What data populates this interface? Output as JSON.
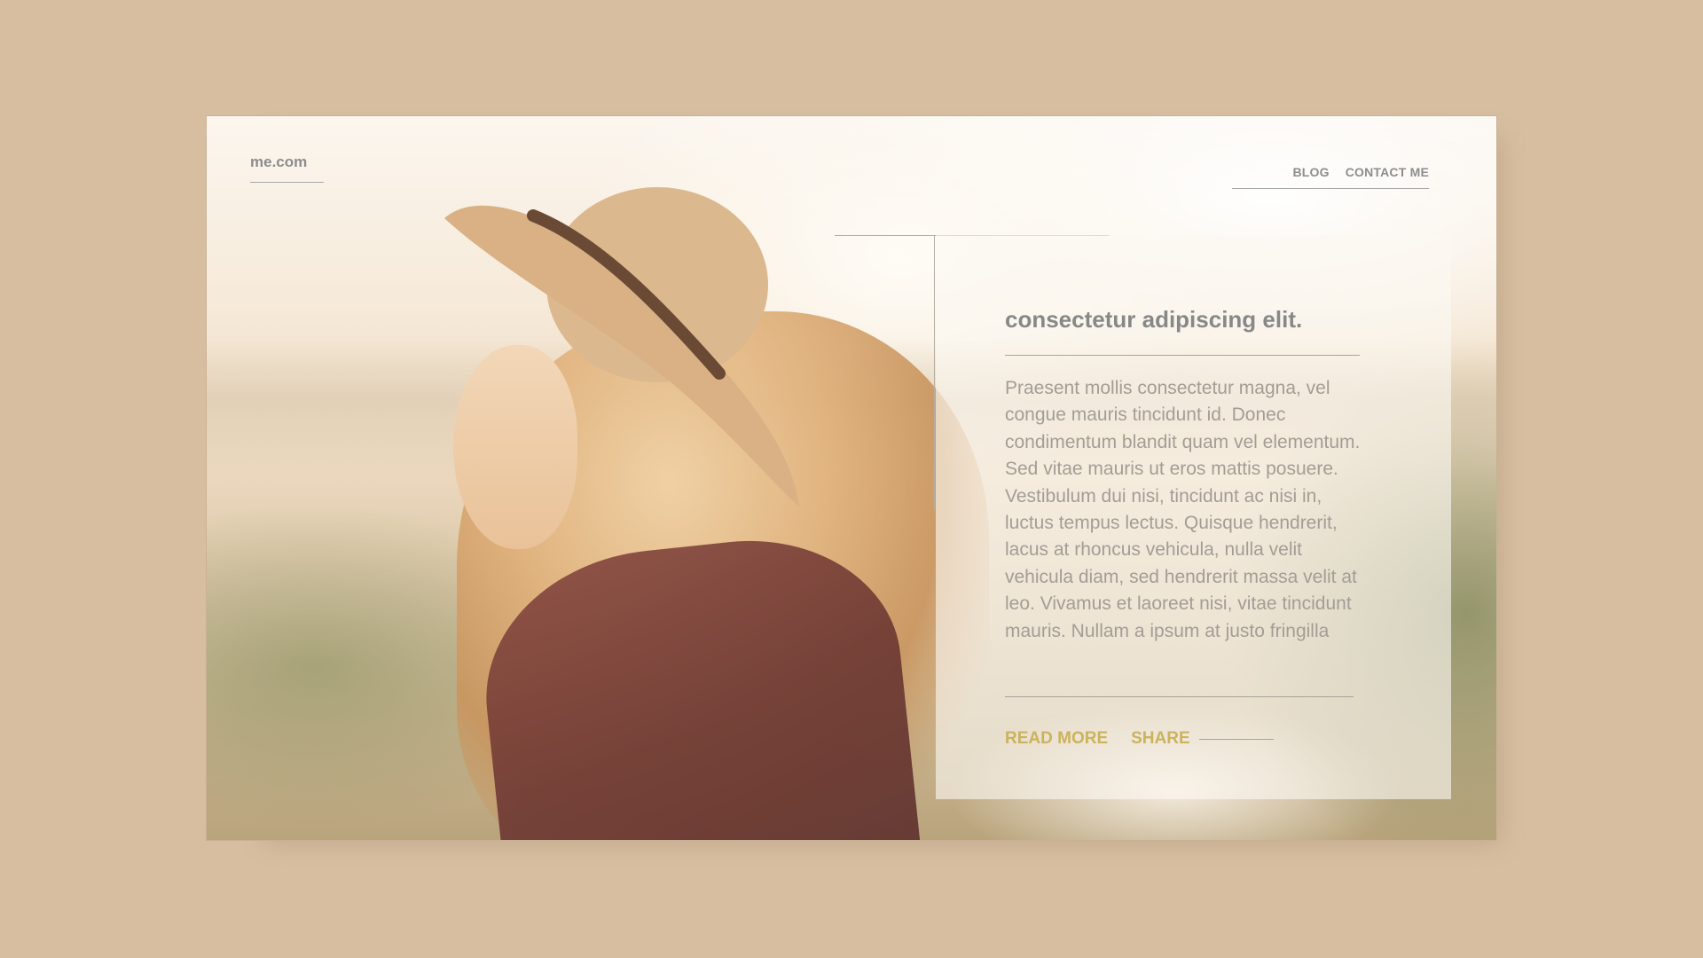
{
  "header": {
    "brand": "me.com",
    "nav": [
      {
        "label": "BLOG"
      },
      {
        "label": "CONTACT ME"
      }
    ]
  },
  "article": {
    "title": "consectetur adipiscing elit.",
    "body": "Praesent mollis consectetur magna, vel congue mauris tincidunt id. Donec condimentum blandit quam vel elementum. Sed vitae mauris ut eros mattis posuere. Vestibulum dui nisi, tincidunt ac nisi in, luctus tempus lectus. Quisque hendrerit, lacus at rhoncus vehicula, nulla velit vehicula diam, sed hendrerit massa velit at leo. Vivamus et laoreet nisi, vitae tincidunt mauris. Nullam a ipsum at justo fringilla",
    "read_more": "READ MORE",
    "share": "SHARE"
  },
  "colors": {
    "background": "#d7bea1",
    "accent": "#cbb35d",
    "text_gray": "#888888"
  },
  "hero_image": "woman-in-hat-backlit-portrait"
}
